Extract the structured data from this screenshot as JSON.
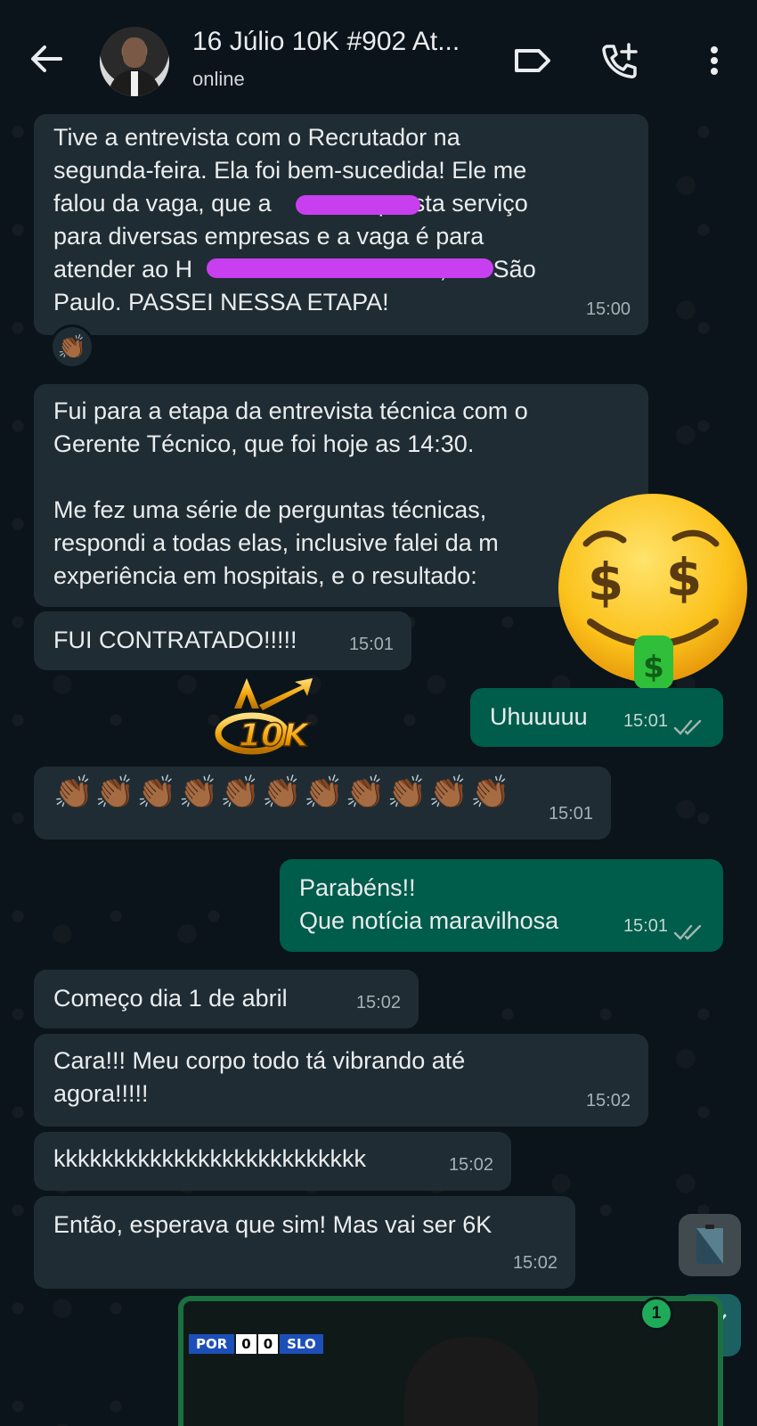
{
  "header": {
    "title": "16 Júlio 10K #902 At...",
    "status": "online"
  },
  "messages": [
    {
      "lines": [
        "Tive a entrevista com o Recrutador  na",
        "segunda-feira. Ela foi bem-sucedida! Ele me",
        "falou da vaga, que a                presta serviço",
        "para diversas empresas e a vaga é para",
        "atender ao H                                     , em São",
        "Paulo. PASSEI NESSA ETAPA!"
      ],
      "time": "15:00"
    },
    {
      "lines": [
        "Fui para a etapa da entrevista técnica com o",
        "Gerente Técnico, que foi hoje as 14:30.",
        "",
        "Me fez uma série de perguntas técnicas,",
        "respondi a todas elas, inclusive falei da m",
        "experiência em hospitais, e o resultado:"
      ]
    },
    {
      "text": "FUI CONTRATADO!!!!!",
      "time": "15:01"
    },
    {
      "text": "Uhuuuuu",
      "time": "15:01"
    },
    {
      "text": "👏🏾👏🏾👏🏾👏🏾👏🏾👏🏾👏🏾👏🏾👏🏾👏🏾👏🏾",
      "time": "15:01"
    },
    {
      "lines": [
        "Parabéns!!",
        "Que notícia maravilhosa"
      ],
      "time": "15:01"
    },
    {
      "text": "Começo dia 1 de abril",
      "time": "15:02"
    },
    {
      "lines": [
        "Cara!!! Meu corpo todo tá vibrando até",
        "agora!!!!!"
      ],
      "time": "15:02"
    },
    {
      "text": "kkkkkkkkkkkkkkkkkkkkkkkkkk",
      "time": "15:02"
    },
    {
      "text": "Então, esperava que sim! Mas vai ser 6K",
      "time": "15:02"
    }
  ],
  "reaction": "👏🏾",
  "logo_text": "10K",
  "media": {
    "team1": "POR",
    "score1": "0",
    "score2": "0",
    "team2": "SLO"
  },
  "unread_badge": "1",
  "colors": {
    "incoming": "#202c33",
    "outgoing": "#005c4b",
    "background": "#0b141a"
  }
}
